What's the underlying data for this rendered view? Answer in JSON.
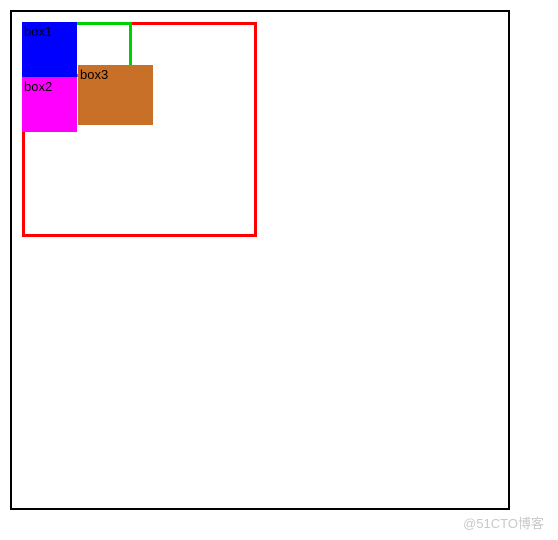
{
  "boxes": {
    "box1": {
      "label": "box1",
      "color": "#0000ff"
    },
    "box2": {
      "label": "box2",
      "color": "#ff00ff"
    },
    "box3": {
      "label": "box3",
      "color": "#c87028"
    }
  },
  "watermark": "@51CTO博客"
}
